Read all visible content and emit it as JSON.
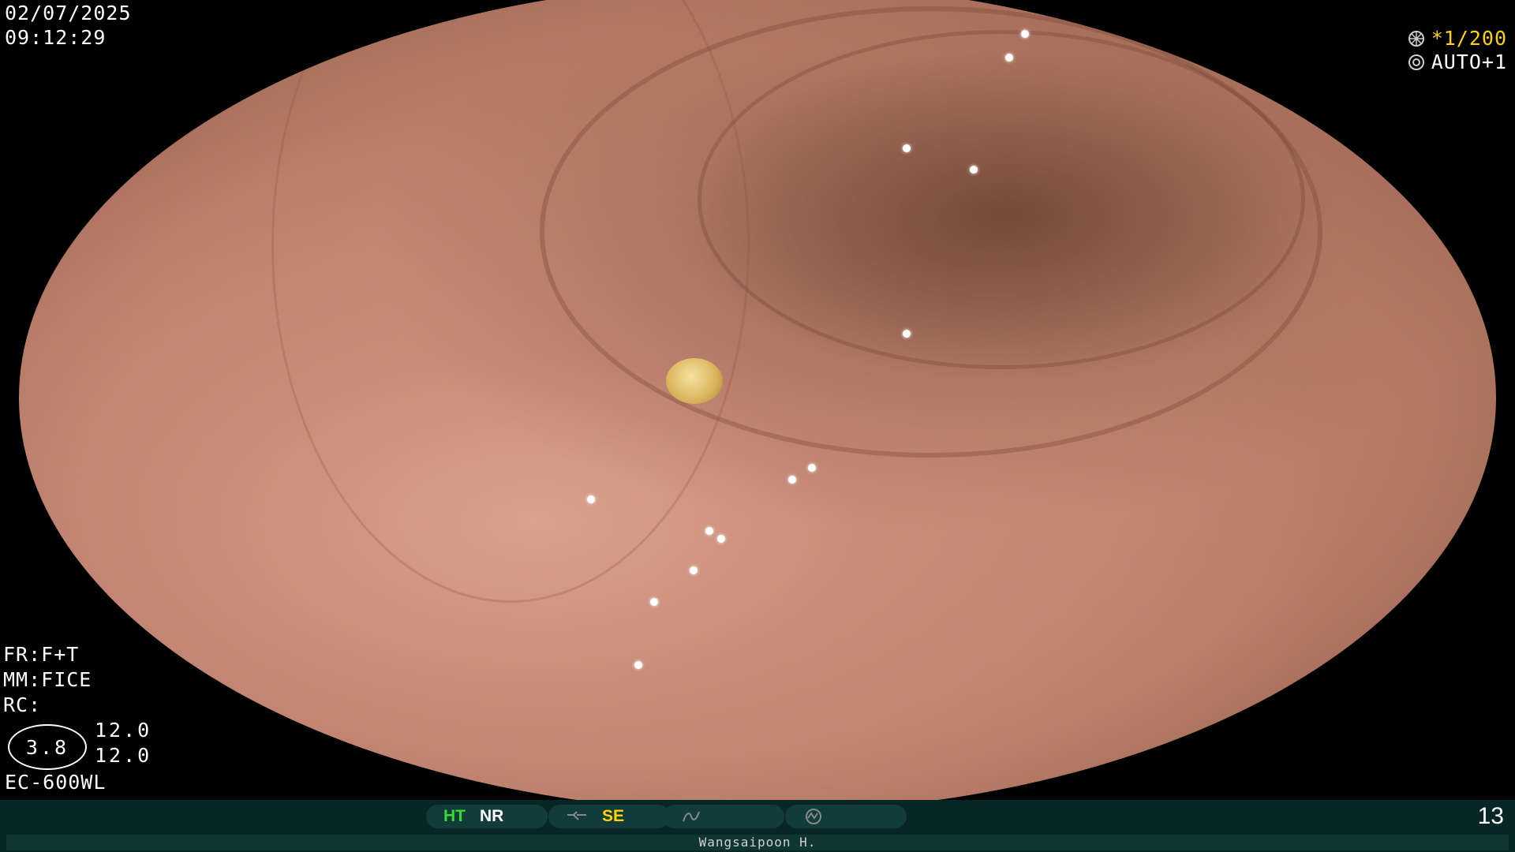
{
  "overlay": {
    "date": "02/07/2025",
    "time": "09:12:29",
    "shutter_speed": "*1/200",
    "auto_mode": "AUTO+1",
    "fr": "FR:F+T",
    "mm": "MM:FICE",
    "rc": "RC:",
    "circle_value": "3.8",
    "readout_1": "12.0",
    "readout_2": "12.0",
    "scope_model": "EC-600WL"
  },
  "status_bar": {
    "ht": "HT",
    "nr": "NR",
    "se": "SE",
    "image_count": "13",
    "operator": "Wangsaipoon H."
  },
  "colors": {
    "ht_green": "#33dd33",
    "se_yellow": "#ffd200",
    "bar_bg": "#082626"
  },
  "icons": [
    "shutter-icon",
    "iris-icon",
    "structure-enhance-icon",
    "color-icon",
    "chromo-icon"
  ]
}
